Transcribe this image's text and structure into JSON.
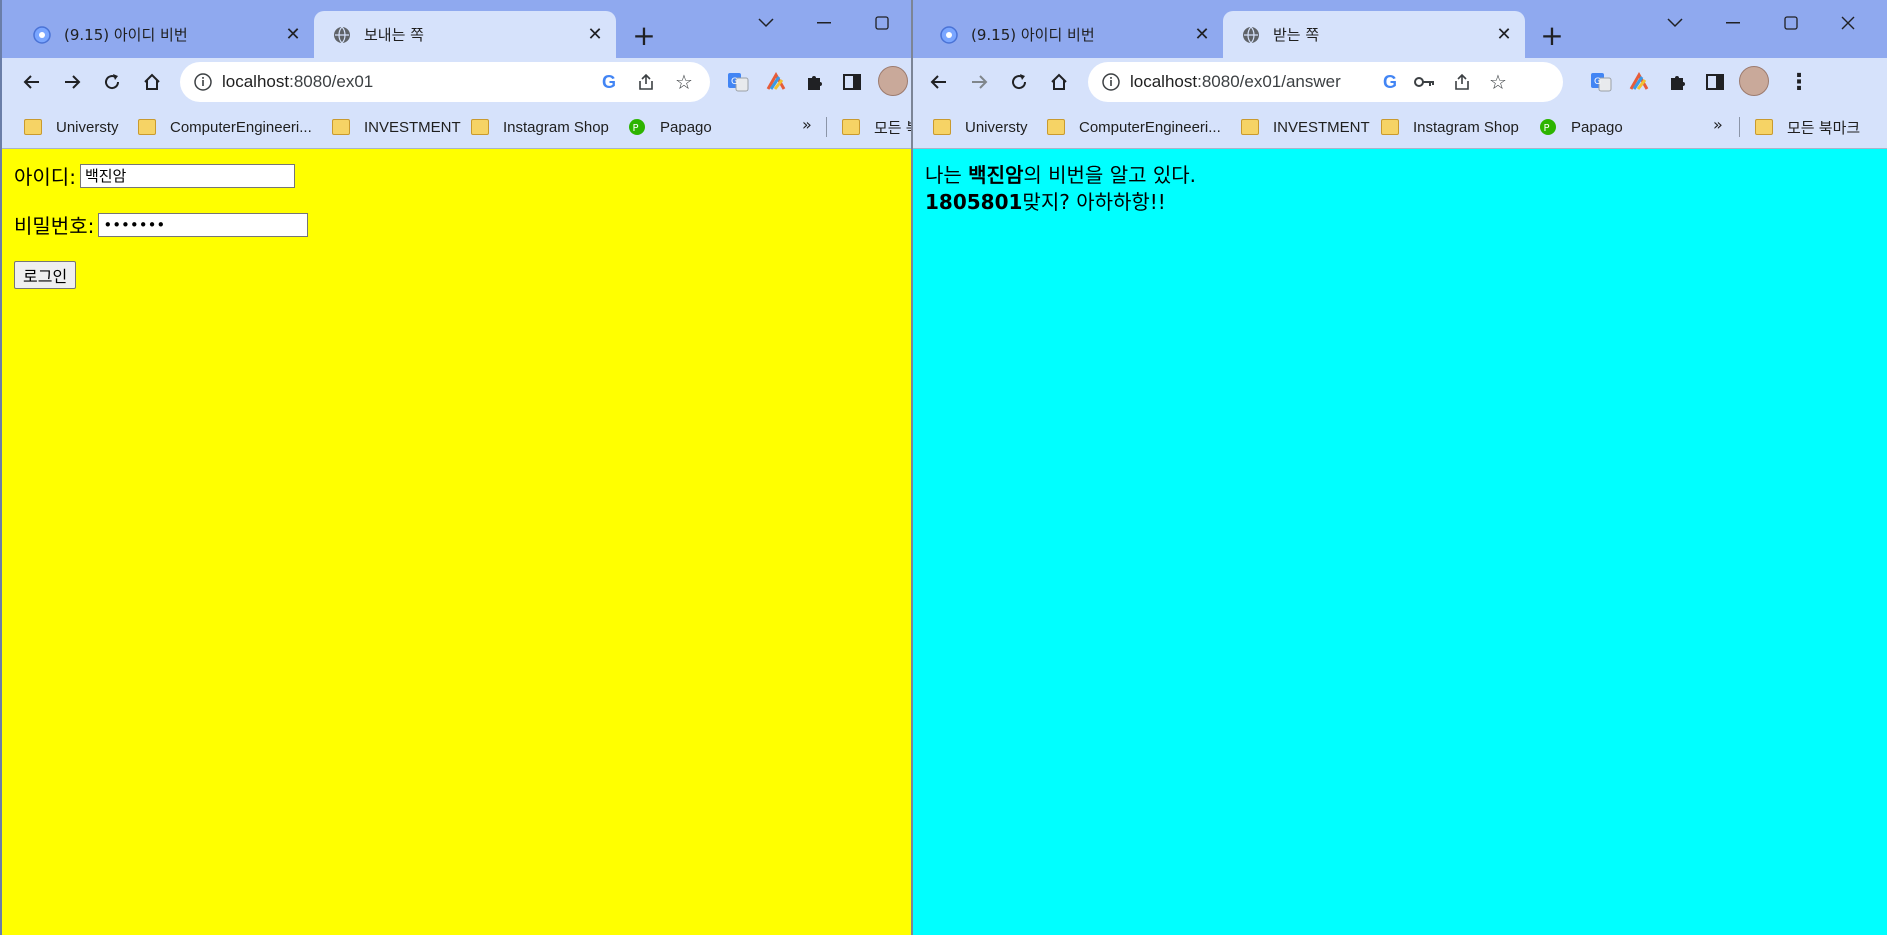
{
  "left_window": {
    "tabs": [
      {
        "title": "(9.15) 아이디 비번",
        "active": false
      },
      {
        "title": "보내는 쪽",
        "active": true
      }
    ],
    "url_host": "localhost",
    "url_path": ":8080/ex01",
    "bookmarks": [
      {
        "label": "Universty",
        "icon": "folder-icon"
      },
      {
        "label": "ComputerEngineeri...",
        "icon": "folder-icon"
      },
      {
        "label": "INVESTMENT",
        "icon": "folder-icon"
      },
      {
        "label": "Instagram Shop",
        "icon": "folder-icon"
      },
      {
        "label": "Papago",
        "icon": "papago-icon"
      }
    ],
    "bookmarks_more": "»",
    "all_bookmarks": "모든 북",
    "page_bg": "#ffff00",
    "form": {
      "id_label": "아이디:",
      "id_value": "백진암",
      "pw_label": "비밀번호:",
      "pw_value": "1805801",
      "login_label": "로그인"
    }
  },
  "right_window": {
    "tabs": [
      {
        "title": "(9.15) 아이디 비번",
        "active": false
      },
      {
        "title": "받는 쪽",
        "active": true
      }
    ],
    "url_host": "localhost",
    "url_path": ":8080/ex01/answer",
    "bookmarks": [
      {
        "label": "Universty",
        "icon": "folder-icon"
      },
      {
        "label": "ComputerEngineeri...",
        "icon": "folder-icon"
      },
      {
        "label": "INVESTMENT",
        "icon": "folder-icon"
      },
      {
        "label": "Instagram Shop",
        "icon": "folder-icon"
      },
      {
        "label": "Papago",
        "icon": "papago-icon"
      }
    ],
    "bookmarks_more": "»",
    "all_bookmarks": "모든 북마크",
    "page_bg": "#00ffff",
    "answer": {
      "line1_prefix": "나는 ",
      "line1_name": "백진암",
      "line1_suffix": "의 비번을 알고 있다.",
      "line2_number": "1805801",
      "line2_suffix": "맞지? 아하하항!!"
    }
  },
  "colors": {
    "tabstrip": "#8fa9ef",
    "toolbar": "#d6e2fb"
  }
}
